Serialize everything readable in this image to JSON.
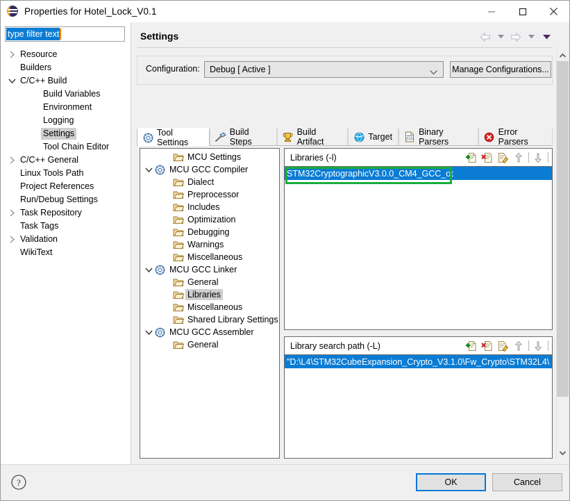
{
  "window": {
    "title": "Properties for Hotel_Lock_V0.1",
    "icon": "eclipse-icon",
    "controls": {
      "minimize": "minimize-icon",
      "maximize": "maximize-icon",
      "close": "close-icon"
    }
  },
  "filter": {
    "value": "type filter text",
    "placeholder": "type filter text"
  },
  "nav_tree": [
    {
      "label": "Resource",
      "indent": 0,
      "twisty": "collapsed",
      "selected": false
    },
    {
      "label": "Builders",
      "indent": 0,
      "twisty": "none",
      "selected": false
    },
    {
      "label": "C/C++ Build",
      "indent": 0,
      "twisty": "expanded",
      "selected": false
    },
    {
      "label": "Build Variables",
      "indent": 1,
      "twisty": "none",
      "selected": false
    },
    {
      "label": "Environment",
      "indent": 1,
      "twisty": "none",
      "selected": false
    },
    {
      "label": "Logging",
      "indent": 1,
      "twisty": "none",
      "selected": false
    },
    {
      "label": "Settings",
      "indent": 1,
      "twisty": "none",
      "selected": true
    },
    {
      "label": "Tool Chain Editor",
      "indent": 1,
      "twisty": "none",
      "selected": false
    },
    {
      "label": "C/C++ General",
      "indent": 0,
      "twisty": "collapsed",
      "selected": false
    },
    {
      "label": "Linux Tools Path",
      "indent": 0,
      "twisty": "none",
      "selected": false
    },
    {
      "label": "Project References",
      "indent": 0,
      "twisty": "none",
      "selected": false
    },
    {
      "label": "Run/Debug Settings",
      "indent": 0,
      "twisty": "none",
      "selected": false
    },
    {
      "label": "Task Repository",
      "indent": 0,
      "twisty": "collapsed",
      "selected": false
    },
    {
      "label": "Task Tags",
      "indent": 0,
      "twisty": "none",
      "selected": false
    },
    {
      "label": "Validation",
      "indent": 0,
      "twisty": "collapsed",
      "selected": false
    },
    {
      "label": "WikiText",
      "indent": 0,
      "twisty": "none",
      "selected": false
    }
  ],
  "page": {
    "title": "Settings",
    "nav": {
      "back": "back-arrow-icon",
      "back_menu": "chevron-down-icon",
      "forward": "forward-arrow-icon",
      "forward_menu": "chevron-down-icon",
      "view_menu": "view-menu-icon"
    }
  },
  "configuration": {
    "label": "Configuration:",
    "selected": "Debug  [ Active ]",
    "options": [
      "Debug  [ Active ]"
    ],
    "manage_button": "Manage Configurations..."
  },
  "tabs": [
    {
      "label": "Tool Settings",
      "icon": "gear-blue-icon",
      "active": true
    },
    {
      "label": "Build Steps",
      "icon": "hammer-icon",
      "active": false
    },
    {
      "label": "Build Artifact",
      "icon": "trophy-icon",
      "active": false
    },
    {
      "label": "Target",
      "icon": "globe-icon",
      "active": false
    },
    {
      "label": "Binary Parsers",
      "icon": "binary-file-icon",
      "active": false
    },
    {
      "label": "Error Parsers",
      "icon": "error-circle-icon",
      "active": false
    }
  ],
  "tool_tree": [
    {
      "label": "MCU Settings",
      "indent": 1,
      "twisty": "none",
      "icon": "folder-icon",
      "selected": false
    },
    {
      "label": "MCU GCC Compiler",
      "indent": 0,
      "twisty": "expanded",
      "icon": "gear-blue-icon",
      "selected": false
    },
    {
      "label": "Dialect",
      "indent": 1,
      "twisty": "none",
      "icon": "folder-icon",
      "selected": false
    },
    {
      "label": "Preprocessor",
      "indent": 1,
      "twisty": "none",
      "icon": "folder-icon",
      "selected": false
    },
    {
      "label": "Includes",
      "indent": 1,
      "twisty": "none",
      "icon": "folder-icon",
      "selected": false
    },
    {
      "label": "Optimization",
      "indent": 1,
      "twisty": "none",
      "icon": "folder-icon",
      "selected": false
    },
    {
      "label": "Debugging",
      "indent": 1,
      "twisty": "none",
      "icon": "folder-icon",
      "selected": false
    },
    {
      "label": "Warnings",
      "indent": 1,
      "twisty": "none",
      "icon": "folder-icon",
      "selected": false
    },
    {
      "label": "Miscellaneous",
      "indent": 1,
      "twisty": "none",
      "icon": "folder-icon",
      "selected": false
    },
    {
      "label": "MCU GCC Linker",
      "indent": 0,
      "twisty": "expanded",
      "icon": "gear-blue-icon",
      "selected": false
    },
    {
      "label": "General",
      "indent": 1,
      "twisty": "none",
      "icon": "folder-icon",
      "selected": false
    },
    {
      "label": "Libraries",
      "indent": 1,
      "twisty": "none",
      "icon": "folder-icon",
      "selected": true
    },
    {
      "label": "Miscellaneous",
      "indent": 1,
      "twisty": "none",
      "icon": "folder-icon",
      "selected": false
    },
    {
      "label": "Shared Library Settings",
      "indent": 1,
      "twisty": "none",
      "icon": "folder-icon",
      "selected": false
    },
    {
      "label": "MCU GCC Assembler",
      "indent": 0,
      "twisty": "expanded",
      "icon": "gear-blue-icon",
      "selected": false
    },
    {
      "label": "General",
      "indent": 1,
      "twisty": "none",
      "icon": "folder-icon",
      "selected": false
    }
  ],
  "libraries_panel": {
    "title": "Libraries (-l)",
    "tools": [
      "add-icon",
      "delete-icon",
      "edit-icon",
      "move-up-icon",
      "move-down-icon"
    ],
    "entries": [
      "STM32CryptographicV3.0.0_CM4_GCC_ot"
    ],
    "highlight_color": "#1aab3c"
  },
  "search_path_panel": {
    "title": "Library search path (-L)",
    "tools": [
      "add-icon",
      "delete-icon",
      "edit-icon",
      "move-up-icon",
      "move-down-icon"
    ],
    "entries": [
      "\"D:\\L4\\STM32CubeExpansion_Crypto_V3.1.0\\Fw_Crypto\\STM32L4\\"
    ]
  },
  "footer": {
    "help": "help-icon",
    "ok": "OK",
    "cancel": "Cancel"
  },
  "colors": {
    "selection_blue": "#0b7cd4",
    "focus_blue": "#0078d7",
    "green_highlight": "#1aab3c",
    "window_bg": "#f0f0f0"
  }
}
